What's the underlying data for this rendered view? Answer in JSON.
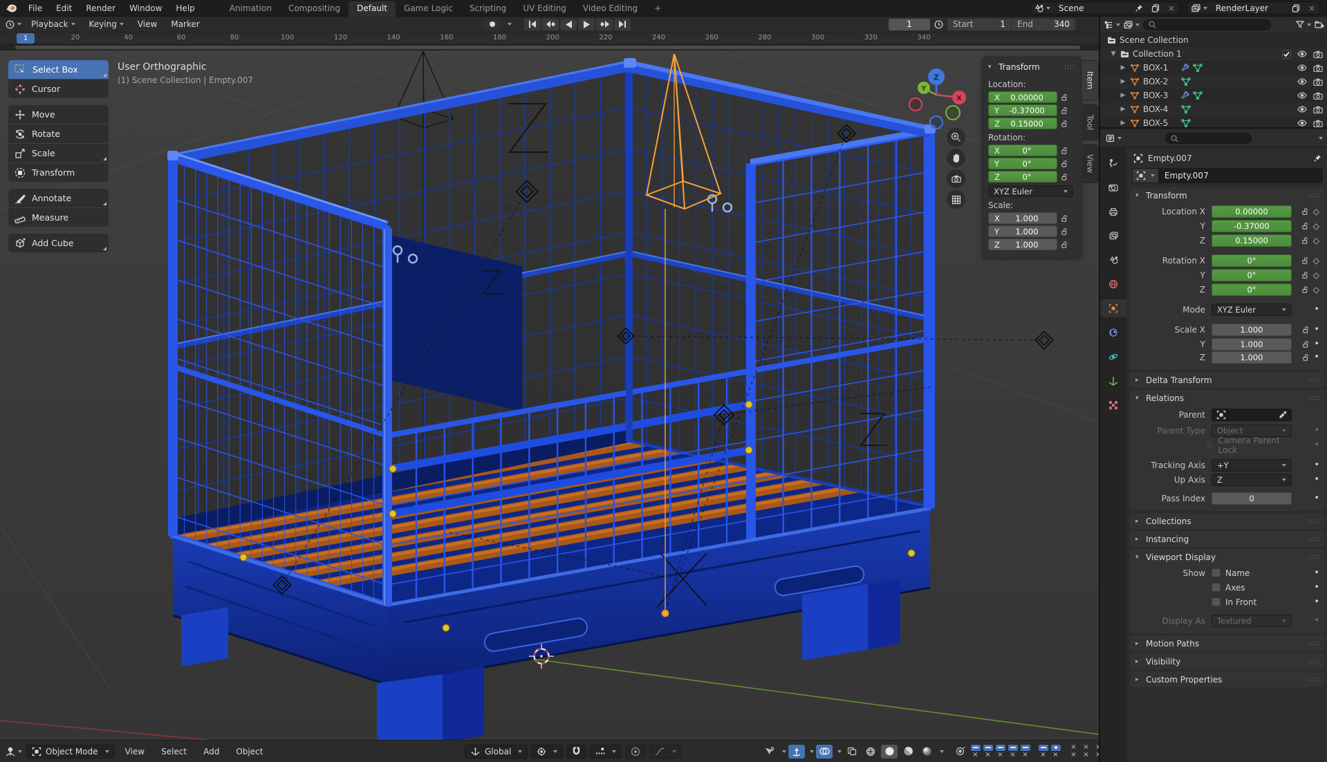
{
  "colors": {
    "accent": "#4772b3",
    "keyed_green": "#539443",
    "object_orange": "#e0833a",
    "meshdata_green": "#41bd8b",
    "wrench_blue": "#7a8fe6",
    "selected_wire": "#f7a23b",
    "cage_blue": "#1e47d6"
  },
  "topbar": {
    "menus": [
      "File",
      "Edit",
      "Render",
      "Window",
      "Help"
    ],
    "workspaces": [
      "Animation",
      "Compositing",
      "Default",
      "Game Logic",
      "Scripting",
      "UV Editing",
      "Video Editing"
    ],
    "active_workspace": "Default",
    "add_workspace": "+",
    "scene": {
      "value": "Scene"
    },
    "view_layer": {
      "value": "RenderLayer"
    }
  },
  "timeline": {
    "menus": [
      "Playback",
      "Keying",
      "View",
      "Marker"
    ],
    "current_frame": "1",
    "start_label": "Start",
    "start_value": "1",
    "end_label": "End",
    "end_value": "340",
    "ticks": [
      20,
      40,
      60,
      80,
      100,
      120,
      140,
      160,
      180,
      200,
      220,
      240,
      260,
      280,
      300,
      320,
      340
    ]
  },
  "toolbar": {
    "tools": [
      {
        "label": "Select Box"
      },
      {
        "label": "Cursor"
      },
      {
        "label": "Move"
      },
      {
        "label": "Rotate"
      },
      {
        "label": "Scale"
      },
      {
        "label": "Transform"
      },
      {
        "label": "Annotate"
      },
      {
        "label": "Measure"
      },
      {
        "label": "Add Cube"
      }
    ]
  },
  "viewport": {
    "view_label": "User Orthographic",
    "context_label": "(1) Scene Collection | Empty.007",
    "axis_x": "X",
    "axis_y": "Y",
    "axis_z": "Z"
  },
  "npanel": {
    "title": "Transform",
    "tabs": [
      "Item",
      "Tool",
      "View"
    ],
    "location_label": "Location:",
    "rotation_label": "Rotation:",
    "scale_label": "Scale:",
    "euler_mode": "XYZ Euler",
    "location": [
      {
        "axis": "X",
        "value": "0.00000"
      },
      {
        "axis": "Y",
        "value": "-0.37000"
      },
      {
        "axis": "Z",
        "value": "0.15000"
      }
    ],
    "rotation": [
      {
        "axis": "X",
        "value": "0°"
      },
      {
        "axis": "Y",
        "value": "0°"
      },
      {
        "axis": "Z",
        "value": "0°"
      }
    ],
    "scale": [
      {
        "axis": "X",
        "value": "1.000"
      },
      {
        "axis": "Y",
        "value": "1.000"
      },
      {
        "axis": "Z",
        "value": "1.000"
      }
    ]
  },
  "outliner": {
    "rows": [
      {
        "label": "Scene Collection"
      },
      {
        "label": "Collection 1"
      },
      {
        "label": "BOX-1",
        "wrench": true
      },
      {
        "label": "BOX-2",
        "wrench": false
      },
      {
        "label": "BOX-3",
        "wrench": true
      },
      {
        "label": "BOX-4",
        "wrench": false
      },
      {
        "label": "BOX-5",
        "wrench": false
      }
    ]
  },
  "properties": {
    "breadcrumb": "Empty.007",
    "name_value": "Empty.007",
    "transform": {
      "title": "Transform",
      "rows": [
        {
          "label": "Location X",
          "value": "0.00000"
        },
        {
          "label": "Y",
          "value": "-0.37000"
        },
        {
          "label": "Z",
          "value": "0.15000"
        },
        {
          "label": "Rotation X",
          "value": "0°"
        },
        {
          "label": "Y",
          "value": "0°"
        },
        {
          "label": "Z",
          "value": "0°"
        }
      ],
      "mode_label": "Mode",
      "mode_value": "XYZ Euler",
      "scale_rows": [
        {
          "label": "Scale X",
          "value": "1.000"
        },
        {
          "label": "Y",
          "value": "1.000"
        },
        {
          "label": "Z",
          "value": "1.000"
        }
      ]
    },
    "delta_transform": "Delta Transform",
    "relations": {
      "title": "Relations",
      "parent_label": "Parent",
      "parent_type_label": "Parent Type",
      "parent_type_value": "Object",
      "camera_parent_lock": "Camera Parent Lock",
      "tracking_label": "Tracking Axis",
      "tracking_value": "+Y",
      "up_label": "Up Axis",
      "up_value": "Z",
      "pass_label": "Pass Index",
      "pass_value": "0"
    },
    "collections": "Collections",
    "instancing": "Instancing",
    "viewport_display": {
      "title": "Viewport Display",
      "show_label": "Show",
      "cb_name": "Name",
      "cb_axes": "Axes",
      "cb_infront": "In Front",
      "display_as_label": "Display As",
      "display_as_value": "Textured"
    },
    "motion_paths": "Motion Paths",
    "visibility": "Visibility",
    "custom_properties": "Custom Properties"
  },
  "vheader": {
    "mode": "Object Mode",
    "menus": [
      "View",
      "Select",
      "Add",
      "Object"
    ],
    "orientation": "Global"
  }
}
